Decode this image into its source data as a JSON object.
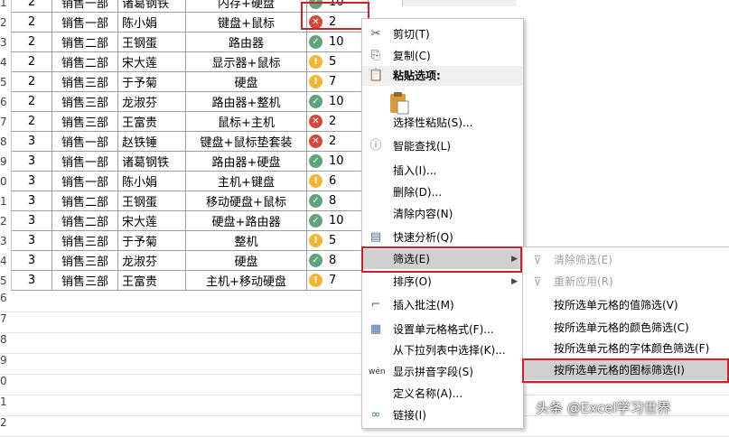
{
  "rows": [
    {
      "rh": "1",
      "a": "2",
      "b": "销售一部",
      "c": "诸葛钢铁",
      "d": "内存+硬盘",
      "icon": "green",
      "e": "10"
    },
    {
      "rh": "2",
      "a": "2",
      "b": "销售一部",
      "c": "陈小娟",
      "d": "键盘+鼠标",
      "icon": "red",
      "e": "2"
    },
    {
      "rh": "3",
      "a": "2",
      "b": "销售二部",
      "c": "王钢蛋",
      "d": "路由器",
      "icon": "green",
      "e": "10"
    },
    {
      "rh": "4",
      "a": "2",
      "b": "销售二部",
      "c": "宋大莲",
      "d": "显示器+鼠标",
      "icon": "yellow",
      "e": "5"
    },
    {
      "rh": "5",
      "a": "2",
      "b": "销售三部",
      "c": "于予菊",
      "d": "硬盘",
      "icon": "yellow",
      "e": "7"
    },
    {
      "rh": "6",
      "a": "2",
      "b": "销售三部",
      "c": "龙淑芬",
      "d": "路由器+整机",
      "icon": "green",
      "e": "10"
    },
    {
      "rh": "7",
      "a": "2",
      "b": "销售三部",
      "c": "王富贵",
      "d": "鼠标+主机",
      "icon": "red",
      "e": "2"
    },
    {
      "rh": "8",
      "a": "3",
      "b": "销售一部",
      "c": "赵铁锤",
      "d": "键盘+鼠标垫套装",
      "icon": "red",
      "e": "2"
    },
    {
      "rh": "9",
      "a": "3",
      "b": "销售一部",
      "c": "诸葛钢铁",
      "d": "路由器+硬盘",
      "icon": "green",
      "e": "10"
    },
    {
      "rh": "0",
      "a": "3",
      "b": "销售一部",
      "c": "陈小娟",
      "d": "主机+键盘",
      "icon": "yellow",
      "e": "6"
    },
    {
      "rh": "1",
      "a": "3",
      "b": "销售二部",
      "c": "王钢蛋",
      "d": "移动硬盘+鼠标",
      "icon": "green",
      "e": "8"
    },
    {
      "rh": "2",
      "a": "3",
      "b": "销售二部",
      "c": "宋大莲",
      "d": "硬盘+路由器",
      "icon": "green",
      "e": "10"
    },
    {
      "rh": "3",
      "a": "3",
      "b": "销售三部",
      "c": "于予菊",
      "d": "整机",
      "icon": "yellow",
      "e": "5"
    },
    {
      "rh": "4",
      "a": "3",
      "b": "销售三部",
      "c": "龙淑芬",
      "d": "硬盘",
      "icon": "green",
      "e": "8"
    },
    {
      "rh": "5",
      "a": "3",
      "b": "销售三部",
      "c": "王富贵",
      "d": "主机+移动硬盘",
      "icon": "yellow",
      "e": "7"
    }
  ],
  "empty_row_headers": [
    "6",
    "7",
    "8",
    "9",
    "0",
    "1",
    "2"
  ],
  "context_menu": {
    "cut": "剪切(T)",
    "copy": "复制(C)",
    "paste_options": "粘贴选项:",
    "paste_special": "选择性粘贴(S)...",
    "smart_lookup": "智能查找(L)",
    "insert": "插入(I)...",
    "delete": "删除(D)...",
    "clear_contents": "清除内容(N)",
    "quick_analysis": "快速分析(Q)",
    "filter": "筛选(E)",
    "sort": "排序(O)",
    "insert_comment": "插入批注(M)",
    "format_cells": "设置单元格格式(F)...",
    "pick_from_list": "从下拉列表中选择(K)...",
    "phonetic": "显示拼音字段(S)",
    "define_name": "定义名称(A)...",
    "link": "链接(I)"
  },
  "filter_submenu": {
    "clear_filter": "清除筛选(E)",
    "reapply": "重新应用(R)",
    "by_value": "按所选单元格的值筛选(V)",
    "by_color": "按所选单元格的颜色筛选(C)",
    "by_font_color": "按所选单元格的字体颜色筛选(F)",
    "by_icon": "按所选单元格的图标筛选(I)"
  },
  "icons": {
    "cut": "scissors-icon",
    "copy": "copy-icon",
    "paste": "clipboard-icon",
    "smart_lookup": "lookup-icon",
    "quick_analysis": "quick-analysis-icon",
    "insert_comment": "comment-icon",
    "format_cells": "format-cells-icon",
    "phonetic": "phonetic-icon",
    "link": "link-icon",
    "clear_filter": "clear-filter-icon",
    "reapply": "reapply-filter-icon"
  },
  "colors": {
    "green": "#5fa37c",
    "yellow": "#f2b632",
    "red": "#d9473b",
    "highlight_box": "#d32027"
  },
  "watermark": "头条 @Excel学习世界"
}
